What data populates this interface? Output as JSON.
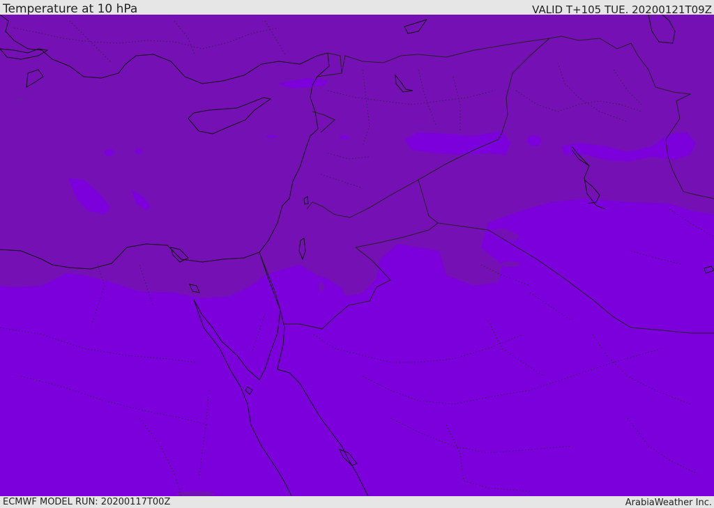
{
  "header": {
    "title": "Temperature at 10 hPa",
    "valid": "VALID T+105 TUE. 20200121T09Z"
  },
  "footer": {
    "model_run": "ECMWF MODEL RUN: 20200117T00Z",
    "credit": "ArabiaWeather Inc."
  },
  "map": {
    "field": "temperature",
    "level": "10 hPa",
    "region": "Eastern Mediterranean and Middle East",
    "colors": {
      "warmer_shade": "#7410b4",
      "colder_shade": "#7c00dc",
      "small_warm_patch": "#6a1aa6",
      "small_cold_patch": "#8200f0",
      "coastline": "#111111",
      "borders": "#222222",
      "admin_borders": "#2a2a2a"
    }
  }
}
